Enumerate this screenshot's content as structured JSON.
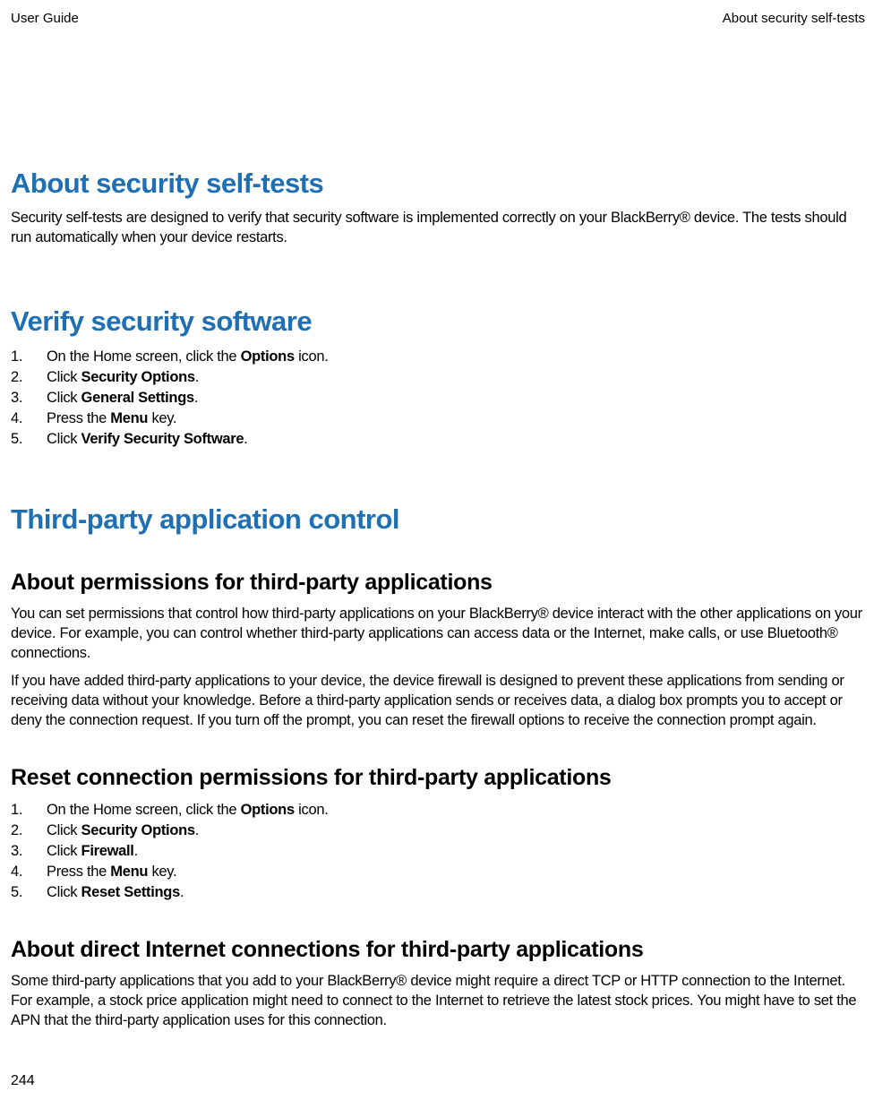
{
  "header": {
    "left": "User Guide",
    "right": "About security self-tests"
  },
  "sections": {
    "about_security": {
      "title": "About security self-tests",
      "para1": "Security self-tests are designed to verify that security software is implemented correctly on your BlackBerry® device. The tests should run automatically when your device restarts."
    },
    "verify": {
      "title": "Verify security software",
      "steps": [
        {
          "num": "1.",
          "pre": "On the Home screen, click the ",
          "bold": "Options",
          "post": " icon."
        },
        {
          "num": "2.",
          "pre": "Click ",
          "bold": "Security Options",
          "post": "."
        },
        {
          "num": "3.",
          "pre": "Click ",
          "bold": "General Settings",
          "post": "."
        },
        {
          "num": "4.",
          "pre": "Press the ",
          "bold": "Menu",
          "post": " key."
        },
        {
          "num": "5.",
          "pre": "Click ",
          "bold": "Verify Security Software",
          "post": "."
        }
      ]
    },
    "third_party": {
      "title": "Third-party application control",
      "about_permissions": {
        "title": "About permissions for third-party applications",
        "para1": "You can set permissions that control how third-party applications on your BlackBerry® device interact with the other applications on your device. For example, you can control whether third-party applications can access data or the Internet, make calls, or use Bluetooth® connections.",
        "para2": "If you have added third-party applications to your device, the device firewall is designed to prevent these applications from sending or receiving data without your knowledge. Before a third-party application sends or receives data, a dialog box prompts you to accept or deny the connection request. If you turn off the prompt, you can reset the firewall options to receive the connection prompt again."
      },
      "reset": {
        "title": "Reset connection permissions for third-party applications",
        "steps": [
          {
            "num": "1.",
            "pre": "On the Home screen, click the ",
            "bold": "Options",
            "post": " icon."
          },
          {
            "num": "2.",
            "pre": "Click ",
            "bold": "Security Options",
            "post": "."
          },
          {
            "num": "3.",
            "pre": "Click ",
            "bold": "Firewall",
            "post": "."
          },
          {
            "num": "4.",
            "pre": "Press the ",
            "bold": "Menu",
            "post": " key."
          },
          {
            "num": "5.",
            "pre": "Click ",
            "bold": "Reset Settings",
            "post": "."
          }
        ]
      },
      "direct": {
        "title": "About direct Internet connections for third-party applications",
        "para1": "Some third-party applications that you add to your BlackBerry® device might require a direct TCP or HTTP connection to the Internet. For example, a stock price application might need to connect to the Internet to retrieve the latest stock prices. You might have to set the APN that the third-party application uses for this connection."
      }
    }
  },
  "page_number": "244"
}
